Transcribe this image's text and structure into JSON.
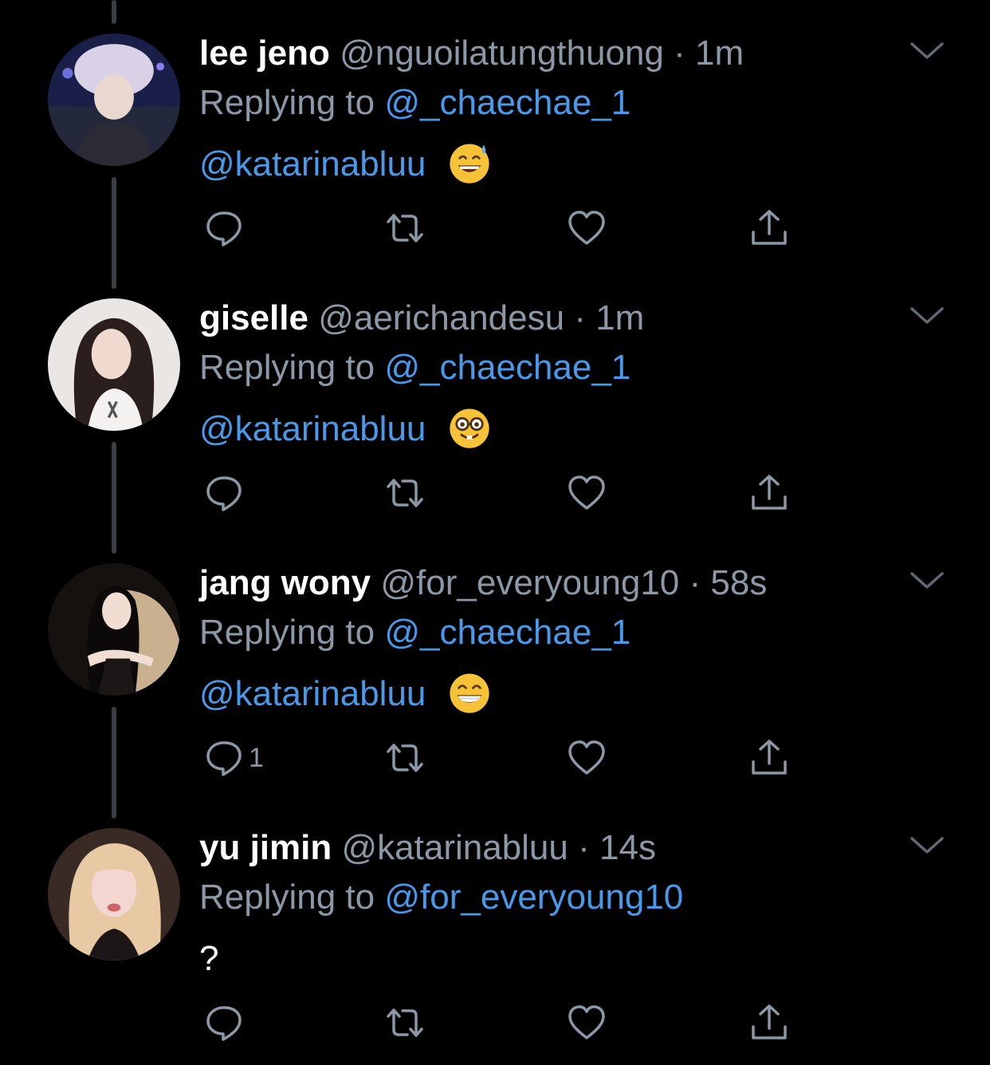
{
  "tweets": [
    {
      "display_name": "lee jeno",
      "handle": "@nguoilatungthuong",
      "separator": "·",
      "time": "1m",
      "replying_prefix": "Replying to",
      "replying_to": "@_chaechae_1",
      "body": "@katarinabluu",
      "emoji": "grinning-face-with-sweat",
      "reply_count": "",
      "avatar_colors": [
        "#1a1f4a",
        "#d9d2e6",
        "#2b2b35"
      ]
    },
    {
      "display_name": "giselle",
      "handle": "@aerichandesu",
      "separator": "·",
      "time": "1m",
      "replying_prefix": "Replying to",
      "replying_to": "@_chaechae_1",
      "body": "@katarinabluu",
      "emoji": "nerd-face",
      "reply_count": "",
      "avatar_colors": [
        "#e9e6e4",
        "#2a1f1c",
        "#f0d9cf"
      ]
    },
    {
      "display_name": "jang wony",
      "handle": "@for_everyoung10",
      "separator": "·",
      "time": "58s",
      "replying_prefix": "Replying to",
      "replying_to": "@_chaechae_1",
      "body": "@katarinabluu",
      "emoji": "beaming-face",
      "reply_count": "1",
      "avatar_colors": [
        "#c9b08f",
        "#14110f",
        "#f2ddd2"
      ]
    },
    {
      "display_name": "yu jimin",
      "handle": "@katarinabluu",
      "separator": "·",
      "time": "14s",
      "replying_prefix": "Replying to",
      "replying_to": "@for_everyoung10",
      "body": "?",
      "emoji": "",
      "reply_count": "",
      "avatar_colors": [
        "#3a2a26",
        "#e7c9a3",
        "#f3d6cf"
      ]
    }
  ],
  "colors": {
    "background": "#000000",
    "secondary_text": "#8b98a5",
    "link": "#4a99e9",
    "thread_line": "#3a3f44"
  },
  "icons": [
    "reply-icon",
    "retweet-icon",
    "like-icon",
    "share-icon",
    "chevron-down-icon"
  ]
}
